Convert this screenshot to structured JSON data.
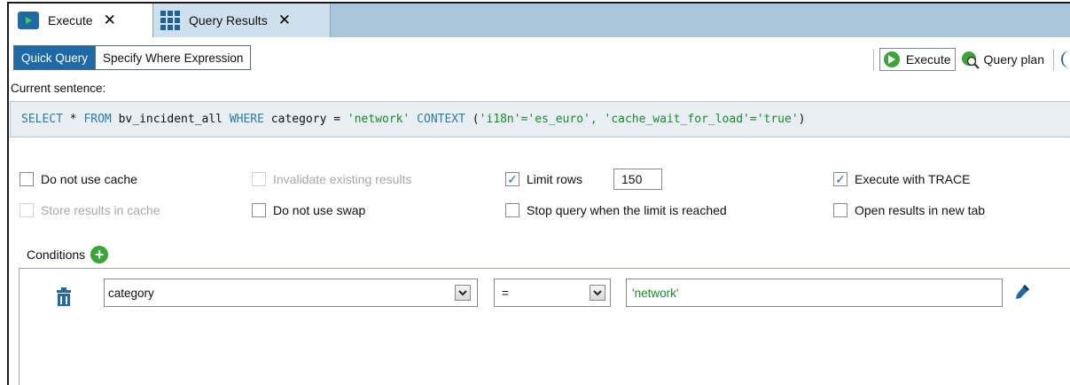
{
  "tabs": [
    {
      "label": "Execute",
      "close": "✕",
      "icon": "play-icon"
    },
    {
      "label": "Query Results",
      "close": "✕",
      "icon": "grid-icon"
    }
  ],
  "mode": {
    "quick_query": "Quick Query",
    "specify_where": "Specify Where Expression"
  },
  "toolbar": {
    "execute": "Execute",
    "query_plan": "Query plan"
  },
  "current_sentence": {
    "label": "Current sentence:",
    "parts": {
      "p1": "SELECT",
      "p2": " * ",
      "p3": "FROM",
      "p4": " bv_incident_all ",
      "p5": "WHERE",
      "p6": " category = ",
      "p7": "'network'",
      "p8": " CONTEXT ",
      "p9": "(",
      "p10": "'i18n'='es_euro', 'cache_wait_for_load'='true'",
      "p11": ")"
    }
  },
  "options": {
    "do_not_use_cache": {
      "label": "Do not use cache",
      "checked": false
    },
    "invalidate_existing": {
      "label": "Invalidate existing results",
      "checked": false,
      "disabled": true
    },
    "limit_rows": {
      "label": "Limit rows",
      "checked": true,
      "value": "150"
    },
    "execute_with_trace": {
      "label": "Execute with TRACE",
      "checked": true
    },
    "store_results": {
      "label": "Store results in cache",
      "checked": false,
      "disabled": true
    },
    "do_not_use_swap": {
      "label": "Do not use swap",
      "checked": false
    },
    "stop_query": {
      "label": "Stop query when the limit is reached",
      "checked": false
    },
    "open_new_tab": {
      "label": "Open results in new tab",
      "checked": false
    }
  },
  "conditions": {
    "label": "Conditions",
    "rows": [
      {
        "field": "category",
        "operator": "=",
        "value": "'network'"
      }
    ]
  },
  "colors": {
    "accent": "#1d6aa6",
    "tab_bar": "#a9c7db",
    "go_green": "#3aa63a",
    "string_green": "#1a8a2a",
    "keyword": "#2e7d9c"
  }
}
